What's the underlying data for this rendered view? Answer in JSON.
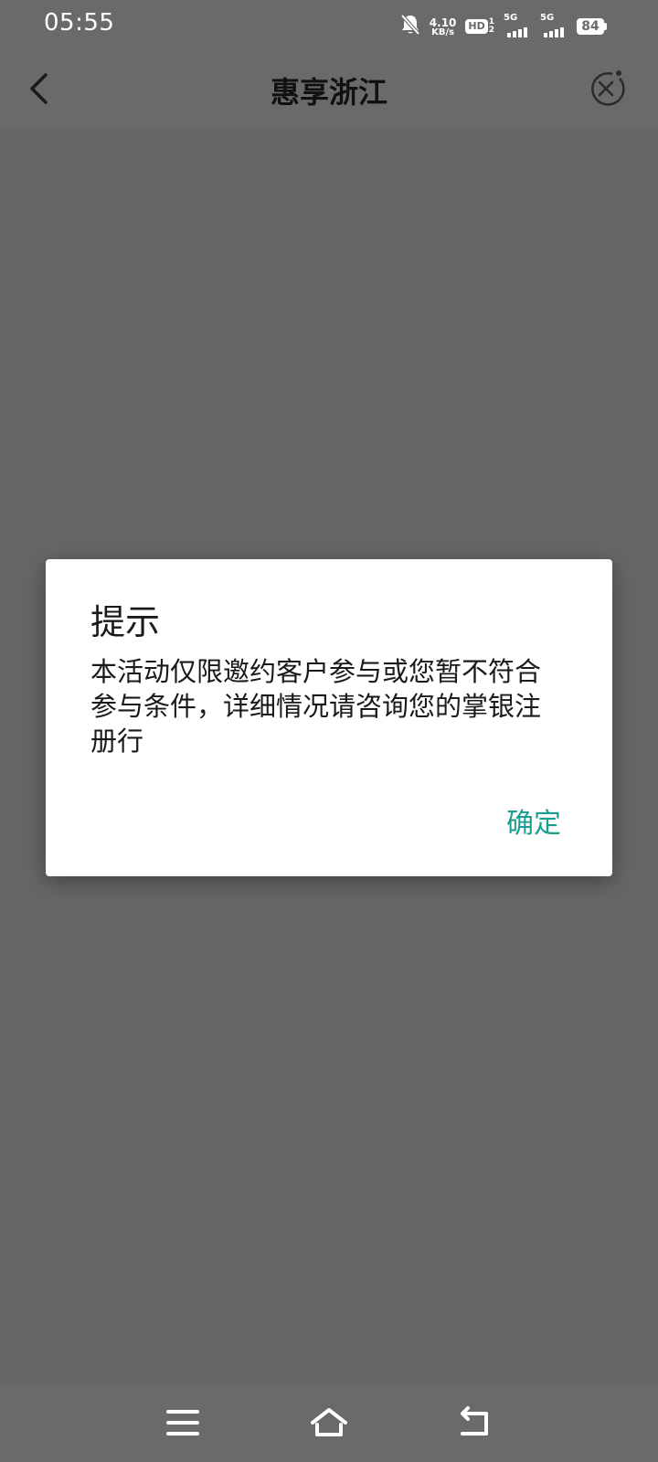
{
  "status_bar": {
    "time": "05:55",
    "net_speed_value": "4.10",
    "net_speed_unit": "KB/s",
    "hd_label": "HD",
    "hd_sim_top": "1",
    "hd_sim_bottom": "2",
    "signal1_label": "5G",
    "signal2_label": "5G",
    "battery_level": "84",
    "icons": [
      "bell-muted-icon",
      "hd-icon",
      "signal-icon",
      "signal-icon",
      "battery-icon"
    ]
  },
  "header": {
    "title": "惠享浙江",
    "back_icon": "chevron-left-icon",
    "close_icon": "close-circle-icon"
  },
  "dialog": {
    "title": "提示",
    "message": "本活动仅限邀约客户参与或您暂不符合参与条件，详细情况请咨询您的掌银注册行",
    "confirm_label": "确定",
    "accent_color": "#1a9e8f"
  },
  "nav_bar": {
    "icons": [
      "menu-icon",
      "home-icon",
      "back-icon"
    ]
  },
  "colors": {
    "overlay_background": "#666666",
    "bar_background": "#6a6a6a"
  }
}
